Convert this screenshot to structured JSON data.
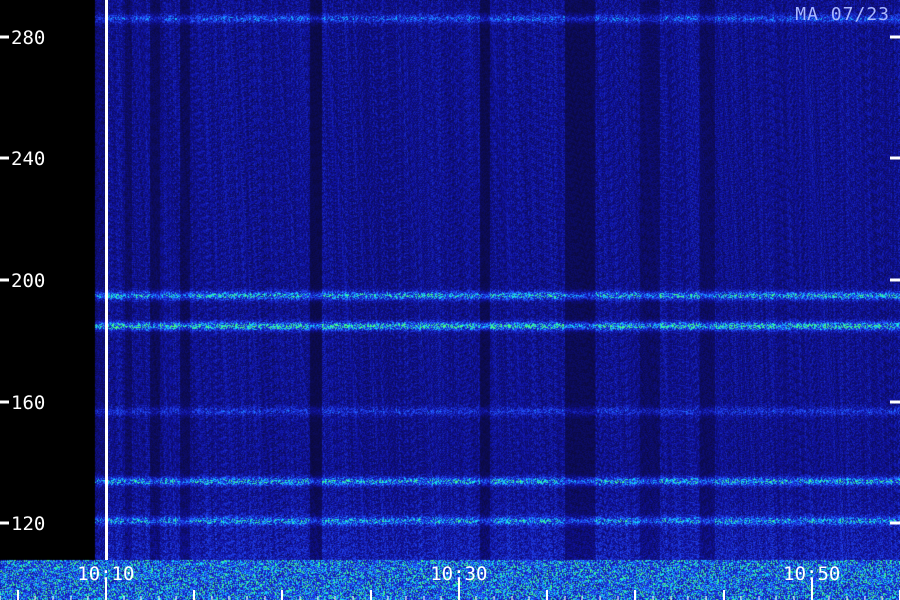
{
  "chart_data": {
    "type": "heatmap",
    "title": "MA 07/23",
    "y_ticks": [
      {
        "value": 280,
        "label": "280"
      },
      {
        "value": 240,
        "label": "240"
      },
      {
        "value": 200,
        "label": "200"
      },
      {
        "value": 160,
        "label": "160"
      },
      {
        "value": 120,
        "label": "120"
      }
    ],
    "y_range": [
      108,
      292
    ],
    "x_ticks": [
      {
        "value": "10:10",
        "label": "10:10"
      },
      {
        "value": "10:30",
        "label": "10:30"
      },
      {
        "value": "10:50",
        "label": "10:50"
      }
    ],
    "x_range": [
      "10:04",
      "10:55"
    ],
    "data_gap": {
      "from": "10:04",
      "to": "10:09"
    },
    "separator_time": "10:10",
    "bright_bands": [
      {
        "value": 185,
        "intensity": 0.95
      },
      {
        "value": 195,
        "intensity": 0.8
      },
      {
        "value": 134,
        "intensity": 0.75
      },
      {
        "value": 121,
        "intensity": 0.6
      },
      {
        "value": 286,
        "intensity": 0.5
      },
      {
        "value": 157,
        "intensity": 0.35
      }
    ],
    "colors": {
      "background": "#000000",
      "low": "#10105a",
      "mid": "#2030e0",
      "high": "#20e0ff",
      "peak": "#40ff80",
      "axis": "#ffffff",
      "title": "#aab8ff"
    }
  }
}
